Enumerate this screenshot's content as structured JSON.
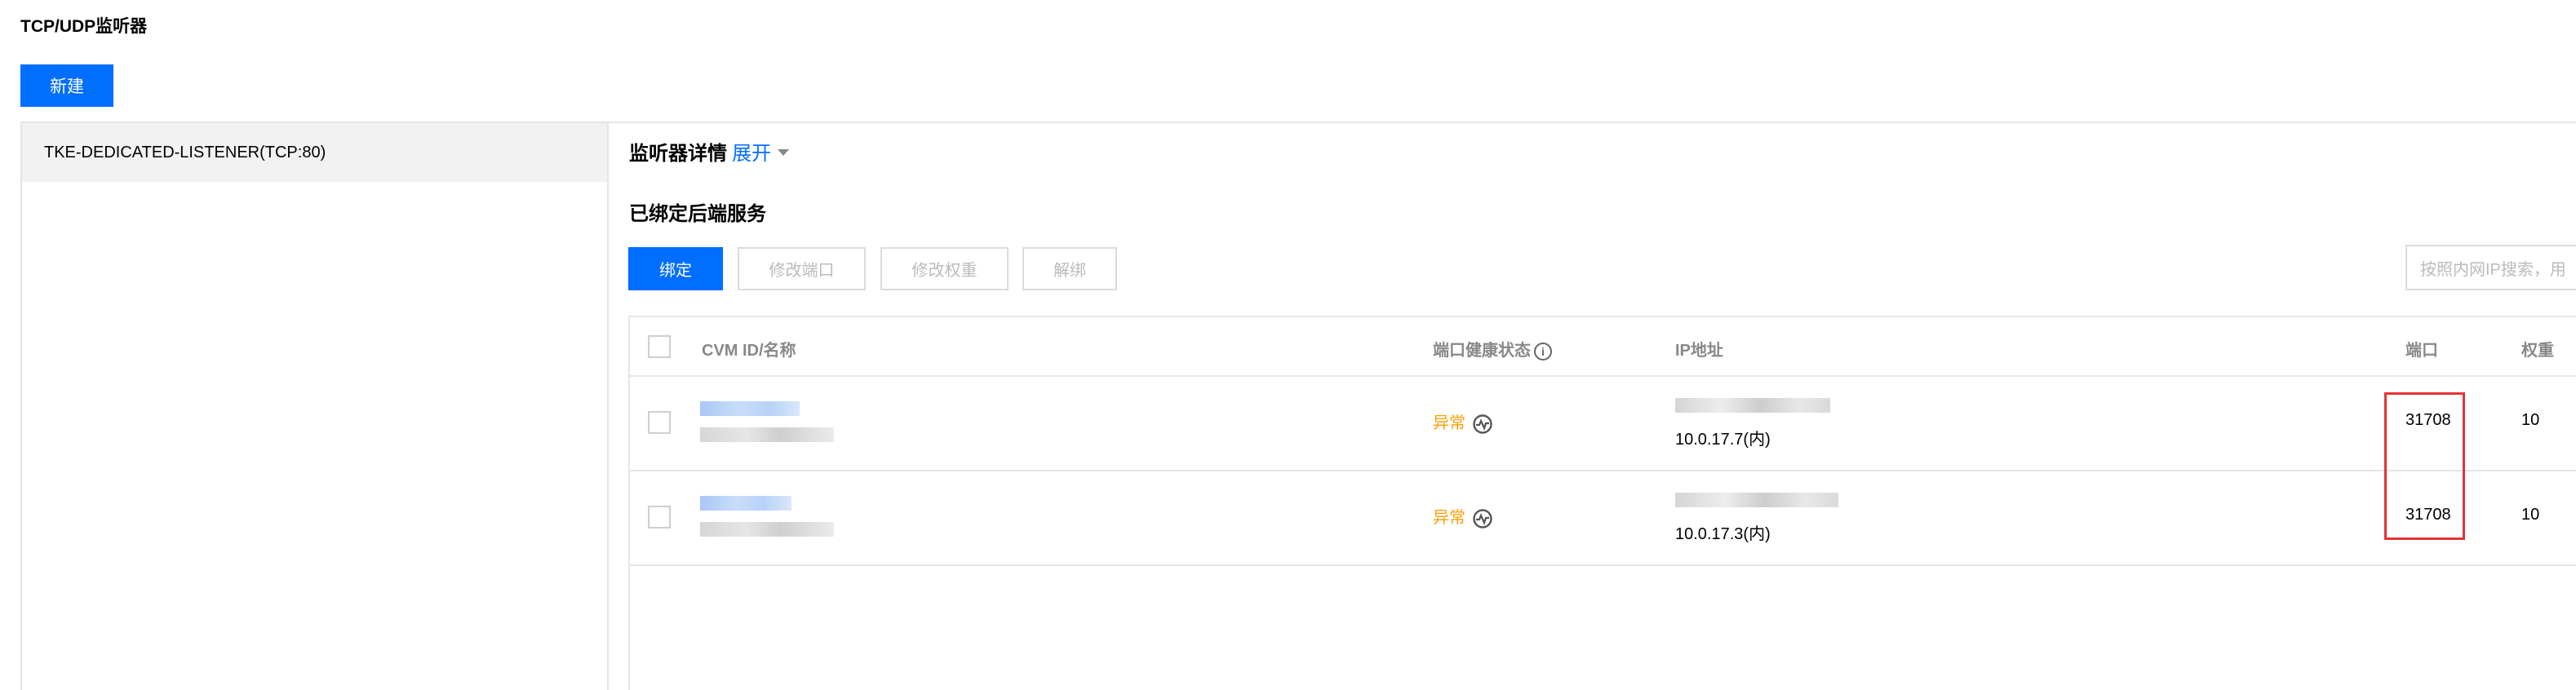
{
  "page": {
    "title": "TCP/UDP监听器"
  },
  "actions": {
    "new_label": "新建"
  },
  "listeners": [
    {
      "label": "TKE-DEDICATED-LISTENER(TCP:80)"
    }
  ],
  "detail": {
    "header": "监听器详情",
    "expand_label": "展开"
  },
  "bound_services": {
    "title": "已绑定后端服务",
    "toolbar": {
      "bind_label": "绑定",
      "modify_port_label": "修改端口",
      "modify_weight_label": "修改权重",
      "unbind_label": "解绑"
    },
    "search": {
      "placeholder": "按照内网IP搜索，用"
    },
    "table": {
      "headers": {
        "cvm": "CVM ID/名称",
        "health": "端口健康状态",
        "ip": "IP地址",
        "port": "端口",
        "weight": "权重"
      },
      "rows": [
        {
          "status": "异常",
          "private_ip": "10.0.17.7(内)",
          "port": "31708",
          "weight": "10"
        },
        {
          "status": "异常",
          "private_ip": "10.0.17.3(内)",
          "port": "31708",
          "weight": "10"
        }
      ]
    }
  },
  "colors": {
    "accent": "#006eff",
    "warning": "#ff9d00",
    "highlight": "#e53333"
  }
}
